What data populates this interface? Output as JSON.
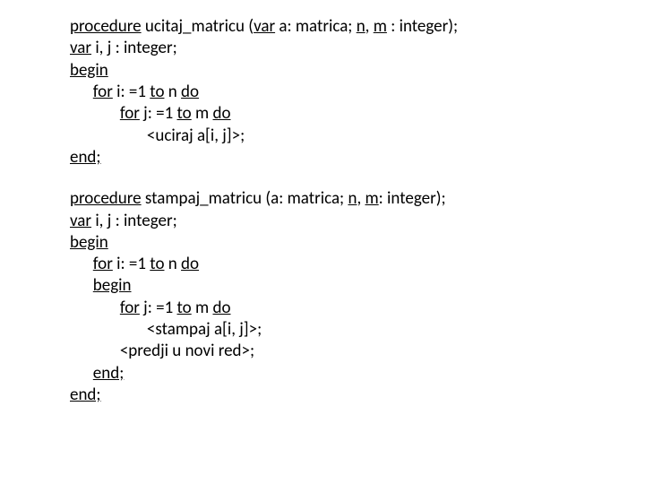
{
  "proc1": {
    "l1": {
      "a": "procedure",
      "b": " ucitaj_matricu (",
      "c": "var",
      "d": " a: matrica; ",
      "e": "n",
      "f": ", ",
      "g": "m",
      "h": " : integer);"
    },
    "l2": {
      "a": "var",
      "b": " i, j : integer;"
    },
    "l3": {
      "a": "begin"
    },
    "l4": {
      "a": "for",
      "b": " i: =1 ",
      "c": "to",
      "d": " n ",
      "e": "do"
    },
    "l5": {
      "a": "for",
      "b": " j: =1 ",
      "c": "to",
      "d": " m ",
      "e": "do"
    },
    "l6": {
      "a": "<uciraj a[i, j]>;"
    },
    "l7": {
      "a": "end;"
    }
  },
  "proc2": {
    "l1": {
      "a": "procedure",
      "b": " stampaj_matricu (a: matrica; ",
      "c": "n",
      "d": ", ",
      "e": "m",
      "f": ": integer);"
    },
    "l2": {
      "a": "var",
      "b": " i, j : integer;"
    },
    "l3": {
      "a": "begin"
    },
    "l4": {
      "a": "for",
      "b": " i: =1 ",
      "c": "to",
      "d": " n ",
      "e": "do"
    },
    "l5": {
      "a": "begin"
    },
    "l6": {
      "a": "for",
      "b": " j: =1 ",
      "c": "to",
      "d": " m ",
      "e": "do"
    },
    "l7": {
      "a": "<stampaj a[i, j]>;"
    },
    "l8": {
      "a": "<predji u novi red>;"
    },
    "l9": {
      "a": "end;"
    },
    "l10": {
      "a": "end;"
    }
  }
}
